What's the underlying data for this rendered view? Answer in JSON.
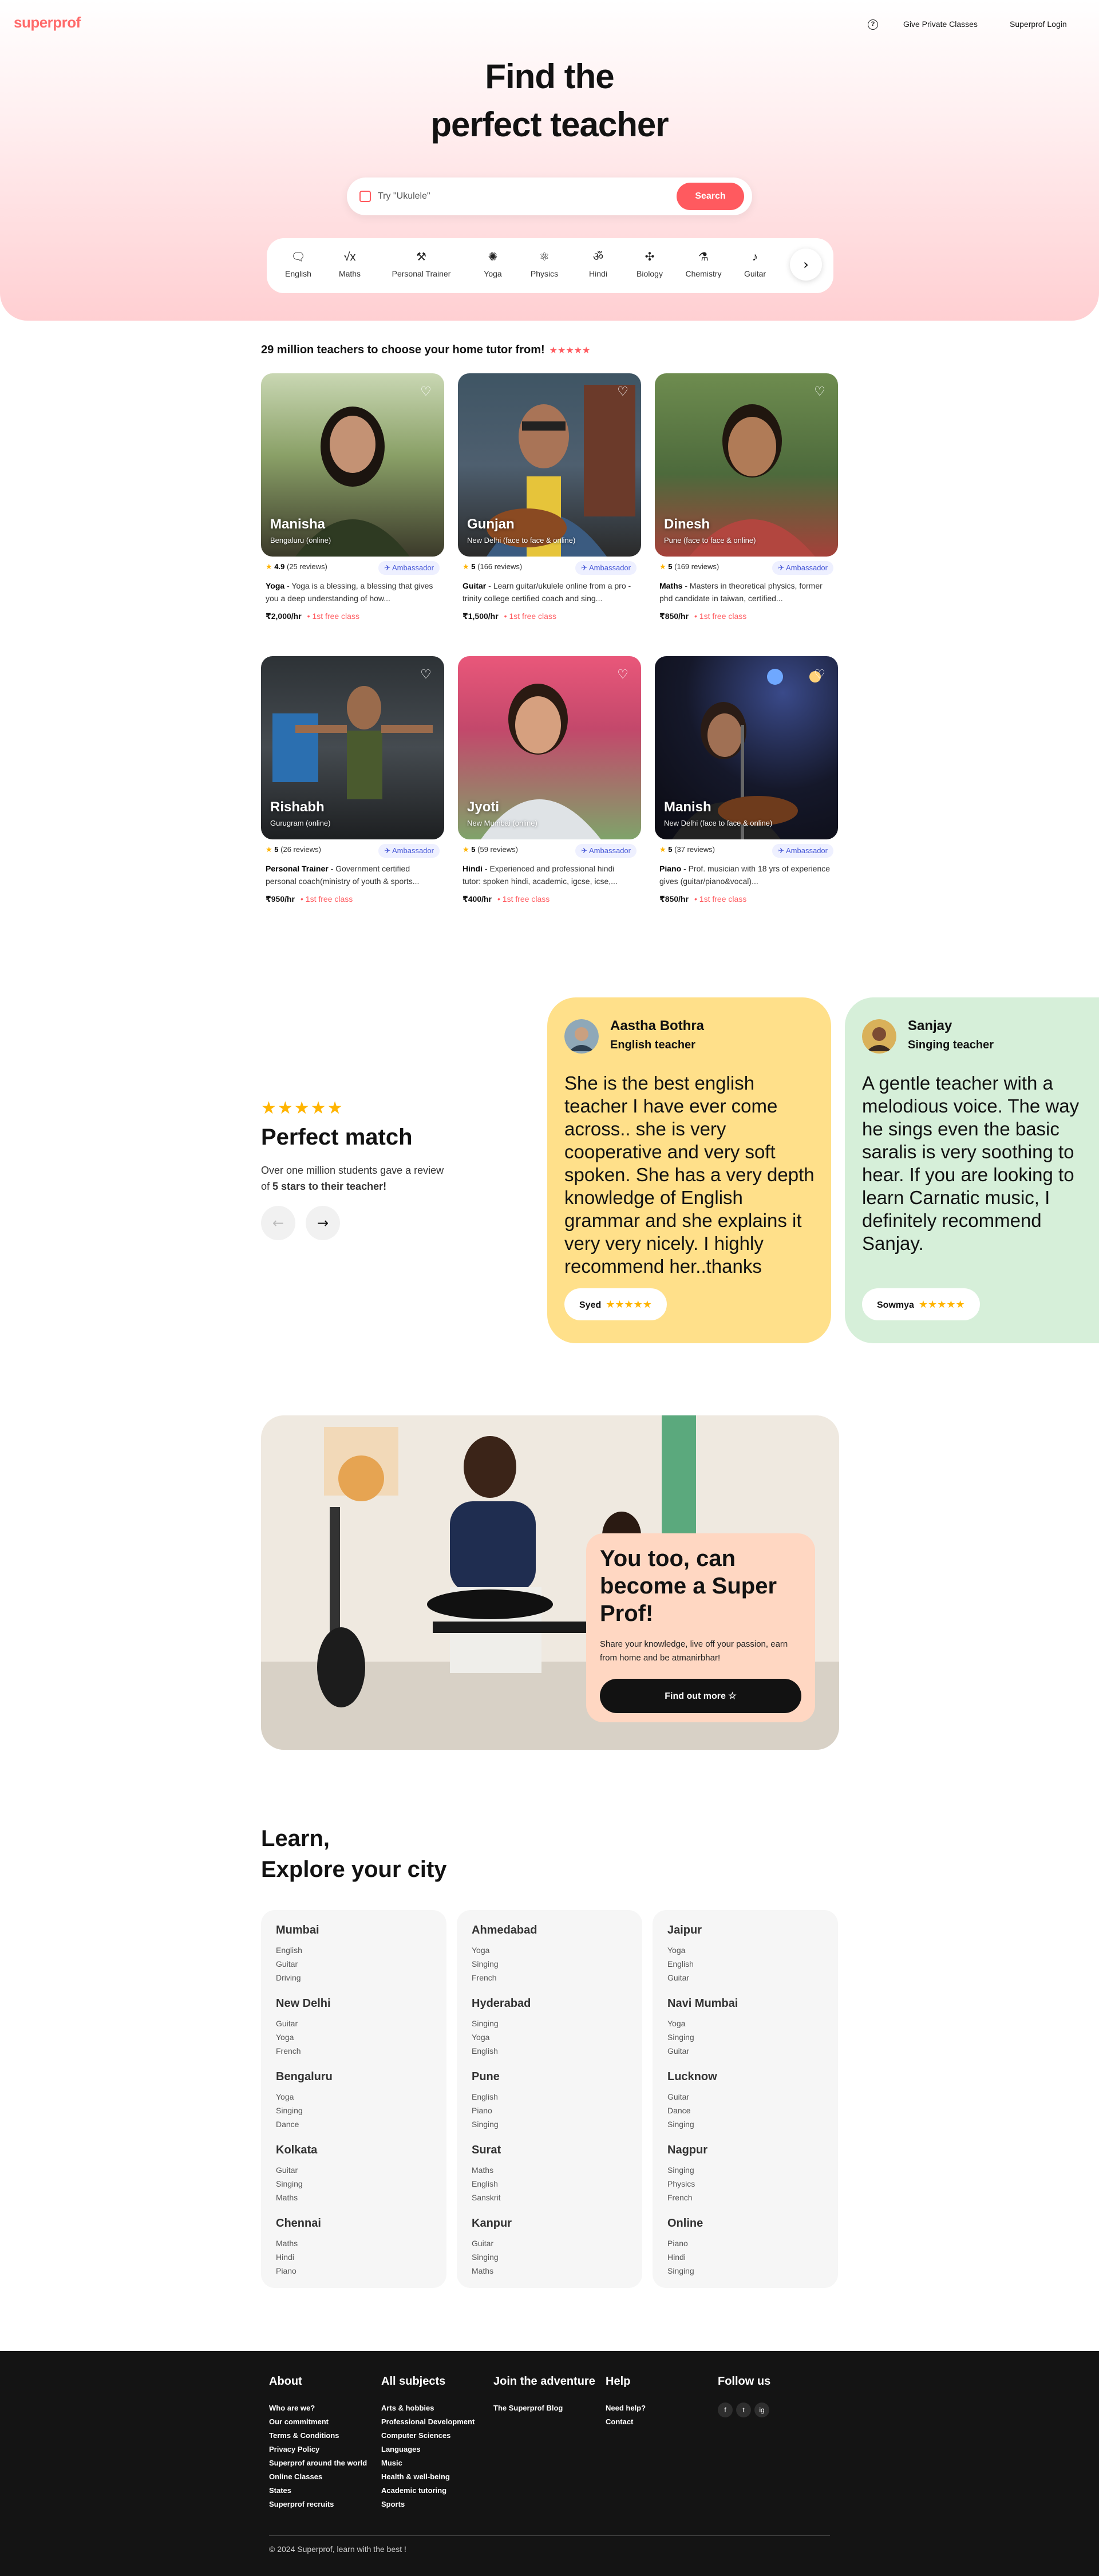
{
  "brand": {
    "logo": "superprof",
    "accent": "#ff5a5f"
  },
  "nav": {
    "give": "Give Private Classes",
    "login": "Superprof Login",
    "help_icon": "help-icon"
  },
  "hero": {
    "title_line1": "Find the",
    "title_line2": "perfect teacher",
    "search_placeholder": "Try \"Ukulele\"",
    "search_button": "Search"
  },
  "categories": [
    "English",
    "Maths",
    "Personal Trainer",
    "Yoga",
    "Physics",
    "Hindi",
    "Biology",
    "Chemistry",
    "Guitar"
  ],
  "teachers_section": {
    "title": "29 million teachers to choose your home tutor from!",
    "stars": "★★★★★"
  },
  "teachers": [
    {
      "name": "Manisha",
      "location": "Bengaluru (online)",
      "rating": "4.9",
      "reviews": "(25 reviews)",
      "badge": "Ambassador",
      "subject": "Yoga",
      "desc": "Yoga is a blessing, a blessing that gives you a deep understanding of how...",
      "price": "₹2,000/hr",
      "free": "1st free class"
    },
    {
      "name": "Gunjan",
      "location": "New Delhi (face to face & online)",
      "rating": "5",
      "reviews": "(166 reviews)",
      "badge": "Ambassador",
      "subject": "Guitar",
      "desc": "Learn guitar/ukulele online from a pro - trinity college certified coach and sing...",
      "price": "₹1,500/hr",
      "free": "1st free class"
    },
    {
      "name": "Dinesh",
      "location": "Pune (face to face & online)",
      "rating": "5",
      "reviews": "(169 reviews)",
      "badge": "Ambassador",
      "subject": "Maths",
      "desc": "Masters in theoretical physics, former phd candidate in taiwan, certified...",
      "price": "₹850/hr",
      "free": "1st free class"
    },
    {
      "name": "Rishabh",
      "location": "Gurugram (online)",
      "rating": "5",
      "reviews": "(26 reviews)",
      "badge": "Ambassador",
      "subject": "Personal Trainer",
      "desc": "Government certified personal coach(ministry of youth & sports...",
      "price": "₹950/hr",
      "free": "1st free class"
    },
    {
      "name": "Jyoti",
      "location": "New Mumbai (online)",
      "rating": "5",
      "reviews": "(59 reviews)",
      "badge": "Ambassador",
      "subject": "Hindi",
      "desc": "Experienced and professional hindi tutor: spoken hindi, academic, igcse, icse,...",
      "price": "₹400/hr",
      "free": "1st free class"
    },
    {
      "name": "Manish",
      "location": "New Delhi (face to face & online)",
      "rating": "5",
      "reviews": "(37 reviews)",
      "badge": "Ambassador",
      "subject": "Piano",
      "desc": "Prof. musician with 18 yrs of experience gives (guitar/piano&vocal)...",
      "price": "₹850/hr",
      "free": "1st free class"
    }
  ],
  "perfect_match": {
    "stars": "★★★★★",
    "title": "Perfect match",
    "sub_pre": "Over one million students gave a review of ",
    "sub_bold": "5 stars to their teacher!"
  },
  "reviews": [
    {
      "name": "Aastha Bothra",
      "role": "English teacher",
      "text": "She is the best english teacher I have ever come across.. she is very cooperative and very soft spoken. She has a very depth knowledge of English grammar and she explains it very very nicely. I highly recommend her..thanks",
      "student": "Syed",
      "stars": "★★★★★",
      "color": "#ffe08a"
    },
    {
      "name": "Sanjay",
      "role": "Singing teacher",
      "text": "A gentle teacher with a melodious voice. The way he sings even the basic saralis is very soothing to hear. If you are looking to learn Carnatic music, I definitely recommend Sanjay.",
      "student": "Sowmya",
      "stars": "★★★★★",
      "color": "#d6efd9"
    }
  ],
  "become": {
    "title": "You too, can become a Super Prof!",
    "sub": "Share your knowledge, live off your passion, earn from home and be atmanirbhar!",
    "button": "Find out more"
  },
  "cities_title": {
    "line1": "Learn,",
    "line2": "Explore your city"
  },
  "cities": [
    [
      {
        "city": "Mumbai",
        "subs": [
          "English",
          "Guitar",
          "Driving"
        ]
      },
      {
        "city": "New Delhi",
        "subs": [
          "Guitar",
          "Yoga",
          "French"
        ]
      },
      {
        "city": "Bengaluru",
        "subs": [
          "Yoga",
          "Singing",
          "Dance"
        ]
      },
      {
        "city": "Kolkata",
        "subs": [
          "Guitar",
          "Singing",
          "Maths"
        ]
      },
      {
        "city": "Chennai",
        "subs": [
          "Maths",
          "Hindi",
          "Piano"
        ]
      }
    ],
    [
      {
        "city": "Ahmedabad",
        "subs": [
          "Yoga",
          "Singing",
          "French"
        ]
      },
      {
        "city": "Hyderabad",
        "subs": [
          "Singing",
          "Yoga",
          "English"
        ]
      },
      {
        "city": "Pune",
        "subs": [
          "English",
          "Piano",
          "Singing"
        ]
      },
      {
        "city": "Surat",
        "subs": [
          "Maths",
          "English",
          "Sanskrit"
        ]
      },
      {
        "city": "Kanpur",
        "subs": [
          "Guitar",
          "Singing",
          "Maths"
        ]
      }
    ],
    [
      {
        "city": "Jaipur",
        "subs": [
          "Yoga",
          "English",
          "Guitar"
        ]
      },
      {
        "city": "Navi Mumbai",
        "subs": [
          "Yoga",
          "Singing",
          "Guitar"
        ]
      },
      {
        "city": "Lucknow",
        "subs": [
          "Guitar",
          "Dance",
          "Singing"
        ]
      },
      {
        "city": "Nagpur",
        "subs": [
          "Singing",
          "Physics",
          "French"
        ]
      },
      {
        "city": "Online",
        "subs": [
          "Piano",
          "Hindi",
          "Singing"
        ]
      }
    ]
  ],
  "footer": {
    "about_title": "About",
    "about": [
      "Who are we?",
      "Our commitment",
      "Terms & Conditions",
      "Privacy Policy",
      "Superprof around the world",
      "Online Classes",
      "States",
      "Superprof recruits"
    ],
    "subjects_title": "All subjects",
    "subjects": [
      "Arts & hobbies",
      "Professional Development",
      "Computer Sciences",
      "Languages",
      "Music",
      "Health & well-being",
      "Academic tutoring",
      "Sports"
    ],
    "join_title": "Join the adventure",
    "join": [
      "The Superprof Blog"
    ],
    "help_title": "Help",
    "help": [
      "Need help?",
      "Contact"
    ],
    "follow_title": "Follow us",
    "social": [
      "f",
      "t",
      "ig"
    ],
    "copyright": "© 2024 Superprof, learn with the best !"
  }
}
